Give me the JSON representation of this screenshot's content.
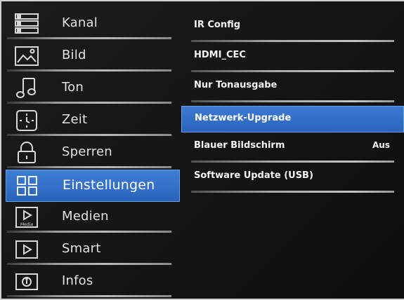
{
  "sidebar": {
    "items": [
      {
        "label": "Kanal",
        "icon": "channel-list-icon"
      },
      {
        "label": "Bild",
        "icon": "picture-icon"
      },
      {
        "label": "Ton",
        "icon": "music-note-icon"
      },
      {
        "label": "Zeit",
        "icon": "clock-icon"
      },
      {
        "label": "Sperren",
        "icon": "lock-icon"
      },
      {
        "label": "Einstellungen",
        "icon": "settings-grid-icon",
        "active": true
      },
      {
        "label": "Medien",
        "icon": "media-play-icon",
        "icon_caption": "Media"
      },
      {
        "label": "Smart",
        "icon": "smart-play-icon"
      },
      {
        "label": "Infos",
        "icon": "info-icon"
      }
    ]
  },
  "menu": {
    "items": [
      {
        "label": "IR Config",
        "value": ""
      },
      {
        "label": "HDMI_CEC",
        "value": ""
      },
      {
        "label": "Nur Tonausgabe",
        "value": ""
      },
      {
        "label": "Netzwerk-Upgrade",
        "value": "",
        "selected": true
      },
      {
        "label": "Blauer Bildschirm",
        "value": "Aus"
      },
      {
        "label": "Software Update (USB)",
        "value": ""
      }
    ]
  },
  "colors": {
    "accent": "#2f6cc4",
    "background": "#141416",
    "text": "#e2e2e2"
  }
}
